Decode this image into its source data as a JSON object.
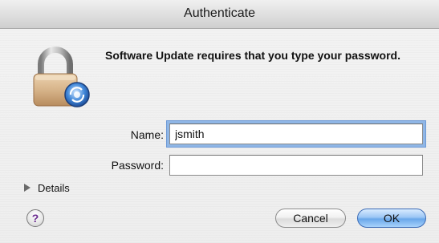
{
  "window": {
    "title": "Authenticate"
  },
  "dialog": {
    "icon": "lock-icon",
    "message": "Software Update requires that you type your password.",
    "name_label": "Name:",
    "name_value": "jsmith",
    "password_label": "Password:",
    "password_value": "",
    "details_label": "Details",
    "help_label": "?",
    "cancel_label": "Cancel",
    "ok_label": "OK"
  },
  "colors": {
    "focus_ring": "#8fb6e6",
    "default_button": "#6aa7ea",
    "lock_body": "#d7b48a"
  }
}
